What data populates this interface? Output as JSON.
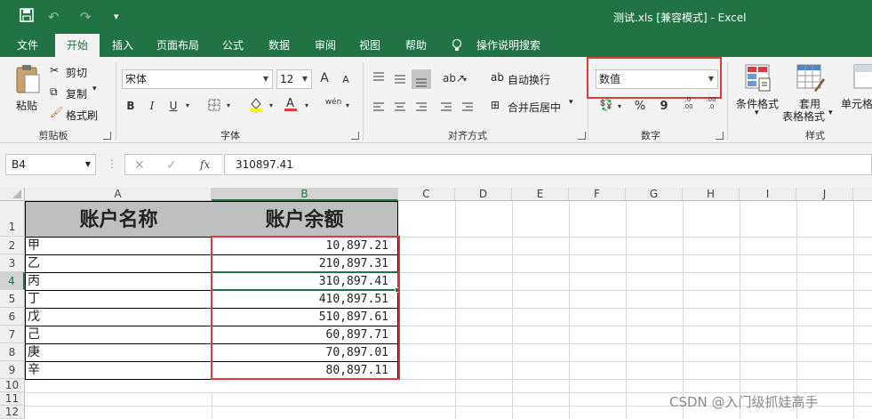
{
  "titlebar": {
    "save_icon": "save-icon",
    "undo_glyph": "↶",
    "redo_glyph": "↷",
    "customize_glyph": "▾",
    "title": "测试.xls [兼容模式] - Excel"
  },
  "tabs": [
    "文件",
    "开始",
    "插入",
    "页面布局",
    "公式",
    "数据",
    "审阅",
    "视图",
    "帮助"
  ],
  "tell_me": "操作说明搜索",
  "ribbon": {
    "clipboard": {
      "paste": "粘贴",
      "cut": "剪切",
      "copy": "复制",
      "format_painter": "格式刷",
      "label": "剪贴板"
    },
    "font": {
      "name": "宋体",
      "size": "12",
      "grow": "A",
      "shrink": "A",
      "bold": "B",
      "italic": "I",
      "underline": "U",
      "phonetic": "wén",
      "label": "字体"
    },
    "alignment": {
      "wrap_text": "自动换行",
      "merge_center": "合并后居中",
      "label": "对齐方式"
    },
    "number": {
      "format": "数值",
      "percent": "%",
      "comma": "9",
      "inc_decimal": ".0 .00",
      "dec_decimal": ".00 .0",
      "label": "数字"
    },
    "styles": {
      "conditional": "条件格式",
      "table_format_1": "套用",
      "table_format_2": "表格格式",
      "cell_styles": "单元格",
      "label": "样式"
    },
    "accent_color": "#217346",
    "highlight_color": "#e0393e"
  },
  "formula_bar": {
    "name_box": "B4",
    "cancel": "✕",
    "enter": "✓",
    "fx": "fx",
    "formula": "310897.41"
  },
  "columns": [
    "A",
    "B",
    "C",
    "D",
    "E",
    "F",
    "G",
    "H",
    "I",
    "J"
  ],
  "rows": [
    "1",
    "2",
    "3",
    "4",
    "5",
    "6",
    "7",
    "8",
    "9",
    "10",
    "11",
    "12"
  ],
  "table": {
    "headers": [
      "账户名称",
      "账户余额"
    ],
    "names": [
      "甲",
      "乙",
      "丙",
      "丁",
      "戊",
      "己",
      "庚",
      "辛"
    ],
    "balances": [
      "10,897.21",
      "210,897.31",
      "310,897.41",
      "410,897.51",
      "510,897.61",
      "60,897.71",
      "70,897.01",
      "80,897.11"
    ]
  },
  "watermark": "CSDN @入门级抓娃高手"
}
